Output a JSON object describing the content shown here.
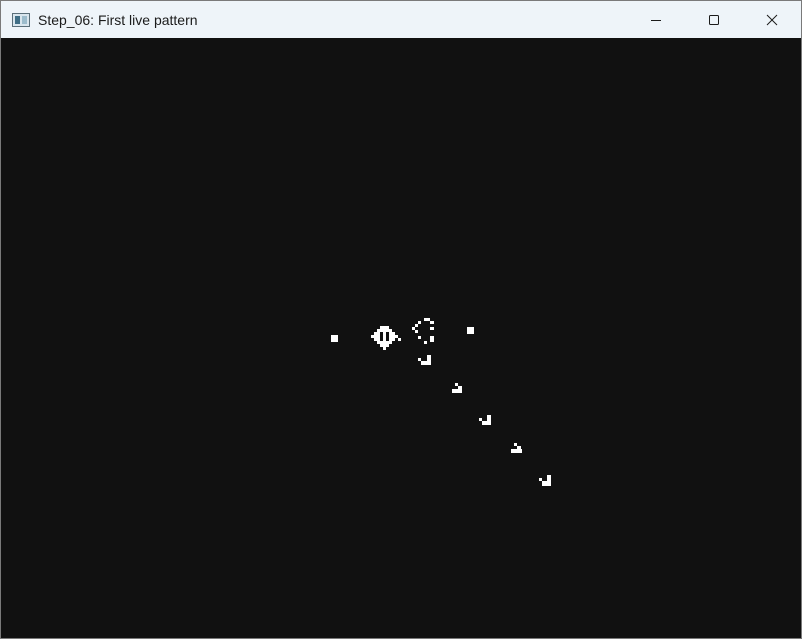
{
  "window": {
    "title": "Step_06: First live pattern"
  },
  "titlebar": {
    "app_icon": "app-window-icon",
    "buttons": [
      {
        "name": "minimize-button",
        "icon": "minimize-icon"
      },
      {
        "name": "maximize-button",
        "icon": "maximize-icon"
      },
      {
        "name": "close-button",
        "icon": "close-icon"
      }
    ]
  },
  "canvas": {
    "background_color": "#111111",
    "cell_color": "#ffffff",
    "pattern": "Gosper glider gun with stream of gliders"
  }
}
